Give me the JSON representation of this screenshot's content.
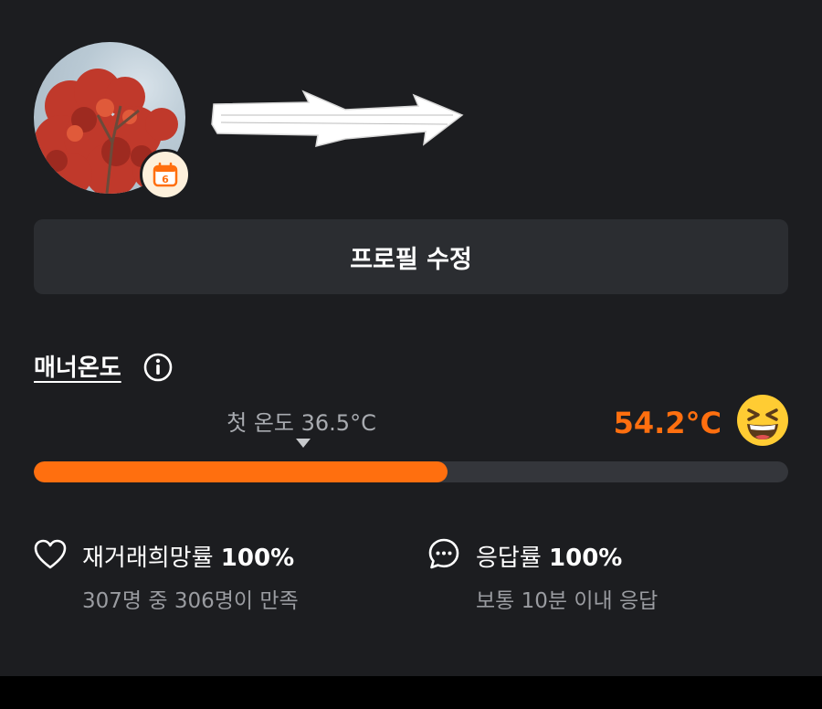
{
  "profile": {
    "edit_button_label": "프로필 수정",
    "badge_icon": "calendar-badge-icon",
    "badge_text": "6"
  },
  "manner": {
    "title": "매너온도",
    "first_temp_label": "첫 온도 36.5°C",
    "current_temp": "54.2°C",
    "progress_fraction": 0.548,
    "accent_color": "#ff6f0f",
    "emoji_icon": "grinning-squinting-face-icon"
  },
  "stats": {
    "rebuy": {
      "label": "재거래희망률",
      "value": "100%",
      "sub": "307명 중 306명이 만족",
      "icon": "heart-outline-icon"
    },
    "response": {
      "label": "응답률",
      "value": "100%",
      "sub": "보통 10분 이내 응답",
      "icon": "chat-bubble-icon"
    }
  }
}
